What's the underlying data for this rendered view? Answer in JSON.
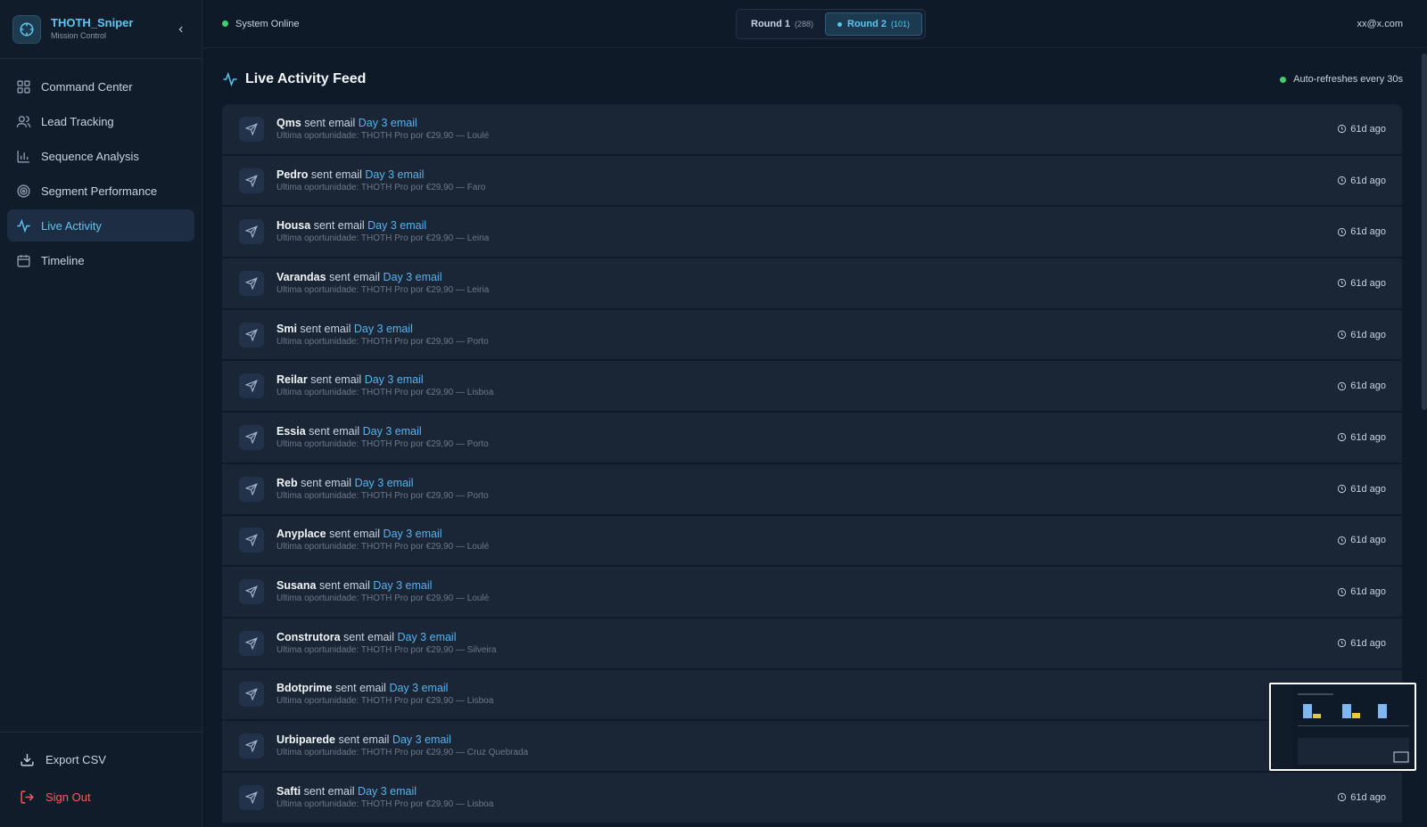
{
  "brand": {
    "title": "THOTH_Sniper",
    "subtitle": "Mission Control"
  },
  "nav": [
    {
      "label": "Command Center",
      "icon": "grid-icon"
    },
    {
      "label": "Lead Tracking",
      "icon": "users-icon"
    },
    {
      "label": "Sequence Analysis",
      "icon": "bar-chart-icon"
    },
    {
      "label": "Segment Performance",
      "icon": "target-icon"
    },
    {
      "label": "Live Activity",
      "icon": "activity-icon",
      "active": true
    },
    {
      "label": "Timeline",
      "icon": "calendar-icon"
    }
  ],
  "bottom": {
    "export": "Export CSV",
    "signout": "Sign Out"
  },
  "topbar": {
    "status": "System Online",
    "rounds": [
      {
        "label": "Round 1",
        "count": "(288)"
      },
      {
        "label": "Round 2",
        "count": "(101)",
        "active": true
      }
    ],
    "user": "xx@x.com"
  },
  "feed": {
    "title": "Live Activity Feed",
    "refresh": "Auto-refreshes every 30s",
    "action_text": "sent email",
    "items": [
      {
        "name": "Qms",
        "email": "Day 3 email",
        "detail": "Ultima oportunidade: THOTH Pro por €29,90 — Loulé",
        "time": "61d ago"
      },
      {
        "name": "Pedro",
        "email": "Day 3 email",
        "detail": "Ultima oportunidade: THOTH Pro por €29,90 — Faro",
        "time": "61d ago"
      },
      {
        "name": "Housa",
        "email": "Day 3 email",
        "detail": "Ultima oportunidade: THOTH Pro por €29,90 — Leiria",
        "time": "61d ago"
      },
      {
        "name": "Varandas",
        "email": "Day 3 email",
        "detail": "Ultima oportunidade: THOTH Pro por €29,90 — Leiria",
        "time": "61d ago"
      },
      {
        "name": "Smi",
        "email": "Day 3 email",
        "detail": "Ultima oportunidade: THOTH Pro por €29,90 — Porto",
        "time": "61d ago"
      },
      {
        "name": "Reilar",
        "email": "Day 3 email",
        "detail": "Ultima oportunidade: THOTH Pro por €29,90 — Lisboa",
        "time": "61d ago"
      },
      {
        "name": "Essia",
        "email": "Day 3 email",
        "detail": "Ultima oportunidade: THOTH Pro por €29,90 — Porto",
        "time": "61d ago"
      },
      {
        "name": "Reb",
        "email": "Day 3 email",
        "detail": "Ultima oportunidade: THOTH Pro por €29,90 — Porto",
        "time": "61d ago"
      },
      {
        "name": "Anyplace",
        "email": "Day 3 email",
        "detail": "Ultima oportunidade: THOTH Pro por €29,90 — Loulé",
        "time": "61d ago"
      },
      {
        "name": "Susana",
        "email": "Day 3 email",
        "detail": "Ultima oportunidade: THOTH Pro por €29,90 — Loulé",
        "time": "61d ago"
      },
      {
        "name": "Construtora",
        "email": "Day 3 email",
        "detail": "Ultima oportunidade: THOTH Pro por €29,90 — Silveira",
        "time": "61d ago"
      },
      {
        "name": "Bdotprime",
        "email": "Day 3 email",
        "detail": "Ultima oportunidade: THOTH Pro por €29,90 — Lisboa",
        "time": ""
      },
      {
        "name": "Urbiparede",
        "email": "Day 3 email",
        "detail": "Ultima oportunidade: THOTH Pro por €29,90 — Cruz Quebrada",
        "time": ""
      },
      {
        "name": "Safti",
        "email": "Day 3 email",
        "detail": "Ultima oportunidade: THOTH Pro por €29,90 — Lisboa",
        "time": "61d ago"
      }
    ]
  }
}
